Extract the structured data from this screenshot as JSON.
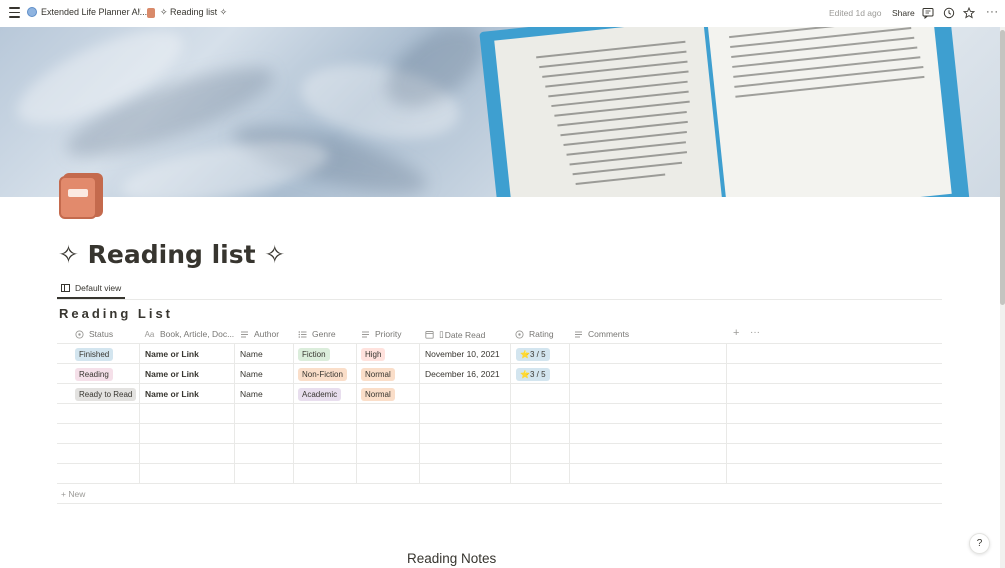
{
  "topbar": {
    "workspace_crumb": "Extended Life Planner Al...",
    "separator": "/",
    "page_crumb": "✧ Reading list ✧",
    "edited": "Edited 1d ago",
    "share": "Share"
  },
  "page": {
    "title": "✧ Reading list ✧",
    "view_tab": "Default view",
    "database_title": "Reading List",
    "section_heading": "Reading Notes",
    "help": "?"
  },
  "table": {
    "columns": [
      "Status",
      "Book, Article, Doc...",
      "Author",
      "Genre",
      "Priority",
      "Date Read",
      "Rating",
      "Comments"
    ],
    "column_icons": [
      "status-icon",
      "text-icon",
      "lines-icon",
      "list-icon",
      "lines-icon",
      "calendar-icon",
      "status-icon",
      "lines-icon"
    ],
    "add_column": "+",
    "more_columns": "···",
    "rows": [
      {
        "status": "Finished",
        "book": "Name or Link",
        "author": "Name",
        "genre": "Fiction",
        "priority": "High",
        "date": "November 10, 2021",
        "rating": "⭐3 / 5",
        "comments": ""
      },
      {
        "status": "Reading",
        "book": "Name or Link",
        "author": "Name",
        "genre": "Non-Fiction",
        "priority": "Normal",
        "date": "December 16, 2021",
        "rating": "⭐3 / 5",
        "comments": ""
      },
      {
        "status": "Ready to Read",
        "book": "Name or Link",
        "author": "Name",
        "genre": "Academic",
        "priority": "Normal",
        "date": "",
        "rating": "",
        "comments": ""
      }
    ],
    "new_label": "+ New"
  },
  "colors": {
    "status_finished": "#d3e5ef",
    "status_reading": "#f5e0e9",
    "status_ready": "#e3e2e0",
    "genre_fiction": "#dbeddb",
    "genre_nonfiction": "#fadec9",
    "genre_academic": "#e8deee",
    "priority_high": "#ffe2dd",
    "priority_normal": "#fadec9",
    "rating": "#d3e5ef"
  }
}
